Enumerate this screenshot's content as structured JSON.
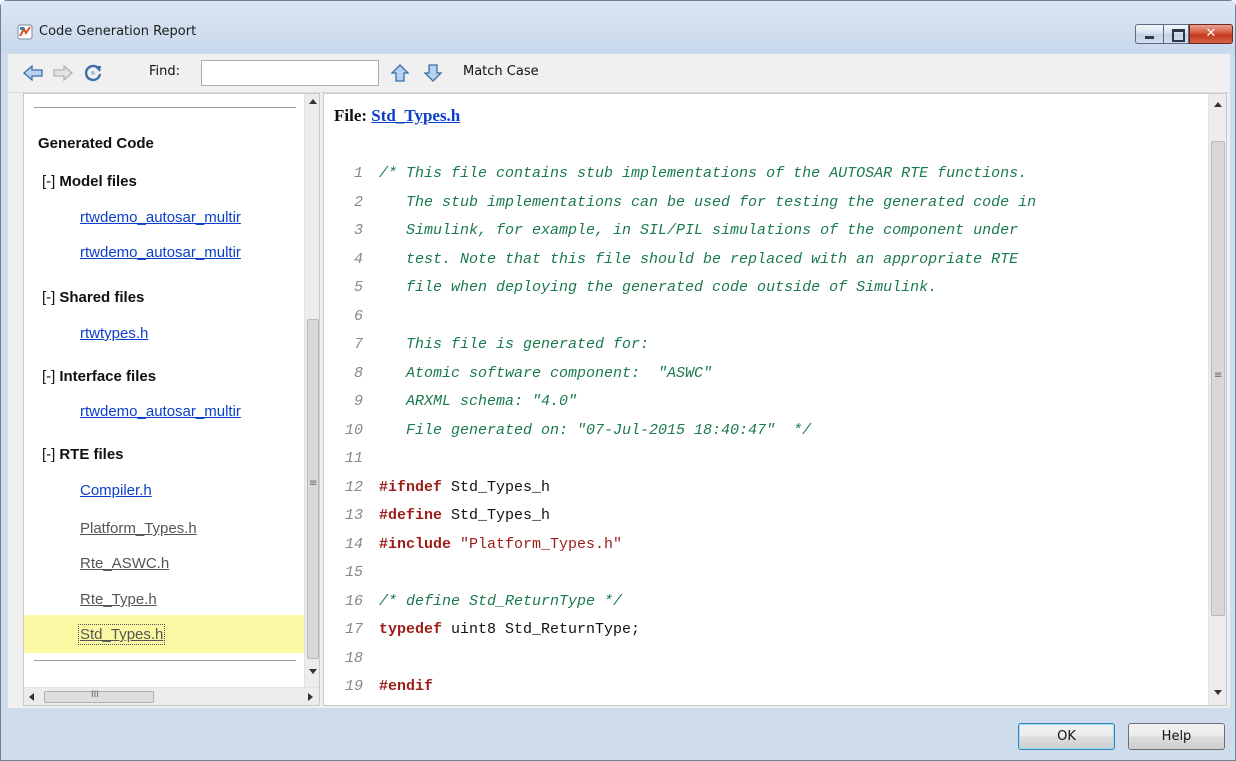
{
  "window": {
    "title": "Code Generation Report",
    "close_glyph": "✕"
  },
  "toolbar": {
    "find_label": "Find:",
    "find_value": "",
    "match_case_label": "Match Case",
    "icons": [
      "back-arrow-icon",
      "forward-arrow-icon",
      "refresh-icon",
      "find-previous-icon",
      "find-next-icon"
    ]
  },
  "nav": {
    "heading": "Generated Code",
    "toggle": "[-]",
    "sections": [
      {
        "title": "Model files",
        "links": [
          "rtwdemo_autosar_multir",
          "rtwdemo_autosar_multir"
        ]
      },
      {
        "title": "Shared files",
        "links": [
          "rtwtypes.h"
        ]
      },
      {
        "title": "Interface files",
        "links": [
          "rtwdemo_autosar_multir"
        ]
      },
      {
        "title": "RTE files",
        "links": [
          "Compiler.h",
          "Platform_Types.h",
          "Rte_ASWC.h",
          "Rte_Type.h",
          "Std_Types.h"
        ]
      }
    ],
    "selected": "Std_Types.h",
    "hscroll_grip": "III",
    "vscroll_grip": "≡"
  },
  "code": {
    "file_prefix": "File: ",
    "file_name": "Std_Types.h",
    "vscroll_grip": "≡",
    "lines": [
      {
        "n": "1",
        "segments": [
          {
            "t": "/* This file contains stub implementations of the AUTOSAR RTE functions.",
            "c": "cm"
          }
        ]
      },
      {
        "n": "2",
        "segments": [
          {
            "t": "   The stub implementations can be used for testing the generated code in",
            "c": "cm"
          }
        ]
      },
      {
        "n": "3",
        "segments": [
          {
            "t": "   Simulink, for example, in SIL/PIL simulations of the component under",
            "c": "cm"
          }
        ]
      },
      {
        "n": "4",
        "segments": [
          {
            "t": "   test. Note that this file should be replaced with an appropriate RTE",
            "c": "cm"
          }
        ]
      },
      {
        "n": "5",
        "segments": [
          {
            "t": "   file when deploying the generated code outside of Simulink.",
            "c": "cm"
          }
        ]
      },
      {
        "n": "6",
        "segments": [
          {
            "t": "",
            "c": "cm"
          }
        ]
      },
      {
        "n": "7",
        "segments": [
          {
            "t": "   This file is generated for:",
            "c": "cm"
          }
        ]
      },
      {
        "n": "8",
        "segments": [
          {
            "t": "   Atomic software component:  \"ASWC\"",
            "c": "cm"
          }
        ]
      },
      {
        "n": "9",
        "segments": [
          {
            "t": "   ARXML schema: \"4.0\"",
            "c": "cm"
          }
        ]
      },
      {
        "n": "10",
        "segments": [
          {
            "t": "   File generated on: \"07-Jul-2015 18:40:47\"  */",
            "c": "cm"
          }
        ]
      },
      {
        "n": "11",
        "segments": []
      },
      {
        "n": "12",
        "segments": [
          {
            "t": "#ifndef",
            "c": "kw"
          },
          {
            "t": " Std_Types_h",
            "c": "plain"
          }
        ]
      },
      {
        "n": "13",
        "segments": [
          {
            "t": "#define",
            "c": "kw"
          },
          {
            "t": " Std_Types_h",
            "c": "plain"
          }
        ]
      },
      {
        "n": "14",
        "segments": [
          {
            "t": "#include",
            "c": "kw"
          },
          {
            "t": " \"Platform_Types.h\"",
            "c": "str"
          }
        ]
      },
      {
        "n": "15",
        "segments": []
      },
      {
        "n": "16",
        "segments": [
          {
            "t": "/* define Std_ReturnType */",
            "c": "cm"
          }
        ]
      },
      {
        "n": "17",
        "segments": [
          {
            "t": "typedef",
            "c": "kw"
          },
          {
            "t": " uint8 Std_ReturnType;",
            "c": "plain"
          }
        ]
      },
      {
        "n": "18",
        "segments": []
      },
      {
        "n": "19",
        "segments": [
          {
            "t": "#endif",
            "c": "kw"
          }
        ]
      }
    ]
  },
  "buttons": {
    "ok": "OK",
    "help": "Help"
  },
  "colors": {
    "link": "#0b3fc9",
    "visited": "#555555",
    "comment": "#1b7a4c",
    "keyword": "#9b1c16",
    "selected_bg": "#fbf9a3"
  }
}
